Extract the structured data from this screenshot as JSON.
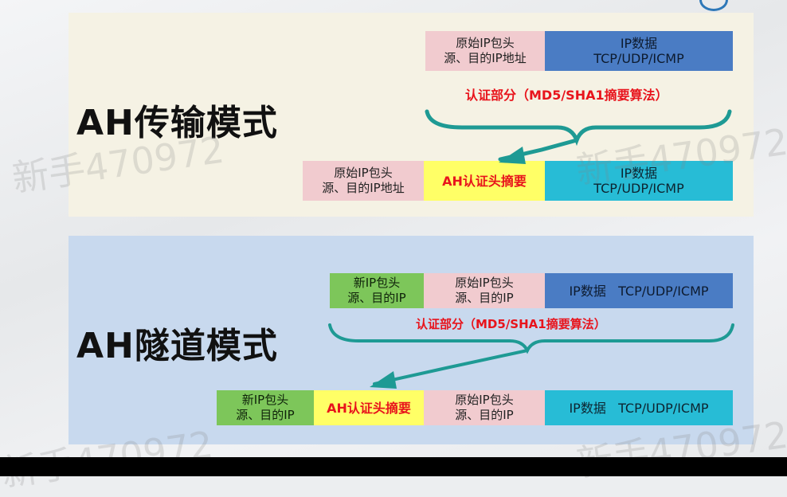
{
  "watermark": "新手470972",
  "section_transport": {
    "title": "AH传输模式",
    "original": {
      "header_line1": "原始IP包头",
      "header_line2": "源、目的IP地址",
      "data_line1": "IP数据",
      "data_line2": "TCP/UDP/ICMP"
    },
    "auth_label": "认证部分（MD5/SHA1摘要算法）",
    "result": {
      "header_line1": "原始IP包头",
      "header_line2": "源、目的IP地址",
      "ah_label": "AH认证头摘要",
      "data_line1": "IP数据",
      "data_line2": "TCP/UDP/ICMP"
    }
  },
  "section_tunnel": {
    "title": "AH隧道模式",
    "original": {
      "new_header_line1": "新IP包头",
      "new_header_line2": "源、目的IP",
      "orig_header_line1": "原始IP包头",
      "orig_header_line2": "源、目的IP",
      "data": "IP数据   TCP/UDP/ICMP"
    },
    "auth_label": "认证部分（MD5/SHA1摘要算法）",
    "result": {
      "new_header_line1": "新IP包头",
      "new_header_line2": "源、目的IP",
      "ah_label": "AH认证头摘要",
      "orig_header_line1": "原始IP包头",
      "orig_header_line2": "源、目的IP",
      "data": "IP数据   TCP/UDP/ICMP"
    }
  },
  "colors": {
    "transport_panel": "#f5f2e4",
    "tunnel_panel": "#c8d9ee",
    "header_pink": "#f1cbcf",
    "data_blue": "#4a7cc4",
    "data_cyan": "#27bcd6",
    "ah_yellow": "#ffff66",
    "new_header_green": "#7dc65a",
    "brace_teal": "#1e9a94",
    "auth_red": "#e8141c"
  }
}
